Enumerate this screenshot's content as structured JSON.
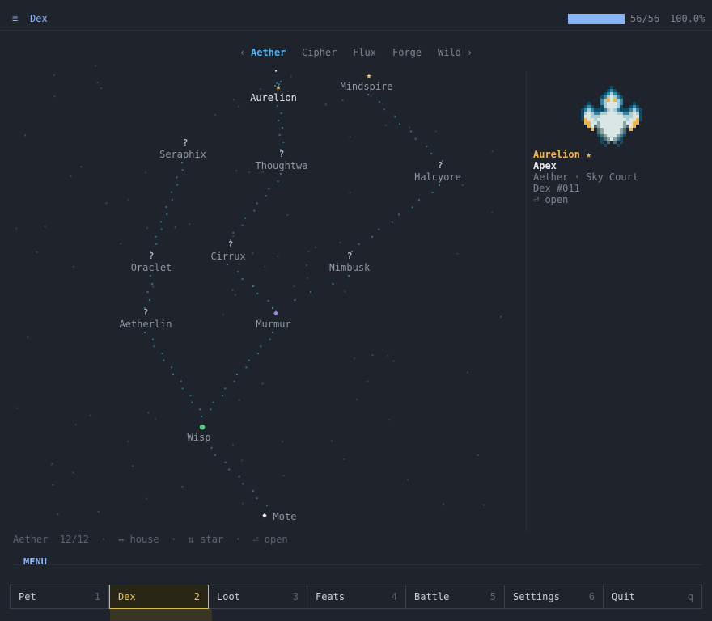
{
  "header": {
    "menu_glyph": "≡",
    "title": "Dex",
    "progress_count": "56/56",
    "progress_pct": "100.0%",
    "progress_fraction": 1.0
  },
  "tabs": {
    "prev": "‹",
    "next": "›",
    "items": [
      {
        "label": "Aether",
        "active": true
      },
      {
        "label": "Cipher",
        "active": false
      },
      {
        "label": "Flux",
        "active": false
      },
      {
        "label": "Forge",
        "active": false
      },
      {
        "label": "Wild",
        "active": false
      }
    ]
  },
  "map": {
    "nodes": [
      {
        "id": "aurelion",
        "label": "Aurelion",
        "marker": "★",
        "marker_kind": "star",
        "active": true
      },
      {
        "id": "mindspire",
        "label": "Mindspire",
        "marker": "★",
        "marker_kind": "star"
      },
      {
        "id": "seraphix",
        "label": "Seraphix",
        "marker": "?",
        "marker_kind": "unknown"
      },
      {
        "id": "thoughtwa",
        "label": "Thoughtwa",
        "marker": "?",
        "marker_kind": "unknown"
      },
      {
        "id": "halcyore",
        "label": "Halcyore",
        "marker": "?",
        "marker_kind": "unknown"
      },
      {
        "id": "oraclet",
        "label": "Oraclet",
        "marker": "?",
        "marker_kind": "unknown"
      },
      {
        "id": "cirrux",
        "label": "Cirrux",
        "marker": "?",
        "marker_kind": "unknown"
      },
      {
        "id": "nimbusk",
        "label": "Nimbusk",
        "marker": "?",
        "marker_kind": "unknown"
      },
      {
        "id": "aetherlin",
        "label": "Aetherlin",
        "marker": "?",
        "marker_kind": "unknown"
      },
      {
        "id": "murmur",
        "label": "Murmur",
        "marker": "◆",
        "marker_kind": "diamond"
      },
      {
        "id": "wisp",
        "label": "Wisp",
        "marker": "●",
        "marker_kind": "dot"
      },
      {
        "id": "mote",
        "label": "Mote",
        "marker": "◆",
        "marker_kind": "white"
      }
    ],
    "top_marker": "•"
  },
  "detail": {
    "name": "Aurelion ★",
    "rank": "Apex",
    "line3": "Aether · Sky Court",
    "dex": "Dex #011",
    "open": "⏎ open"
  },
  "status": {
    "region": "Aether",
    "count": "12/12",
    "sep": "·",
    "house_hint": "↔ house",
    "star_hint": "⇅ star",
    "open_hint": "⏎ open"
  },
  "menu": {
    "heading": "MENU",
    "items": [
      {
        "label": "Pet",
        "key": "1",
        "active": false
      },
      {
        "label": "Dex",
        "key": "2",
        "active": true
      },
      {
        "label": "Loot",
        "key": "3",
        "active": false
      },
      {
        "label": "Feats",
        "key": "4",
        "active": false
      },
      {
        "label": "Battle",
        "key": "5",
        "active": false
      },
      {
        "label": "Settings",
        "key": "6",
        "active": false
      },
      {
        "label": "Quit",
        "key": "q",
        "active": false
      }
    ]
  },
  "colors": {
    "background": "#1f232b",
    "accent": "#8ab4f8",
    "tab_active": "#4fb5f5",
    "star": "#f5c46a",
    "menu_active": "#f5c542",
    "path_dots": "#2f8fb0"
  }
}
